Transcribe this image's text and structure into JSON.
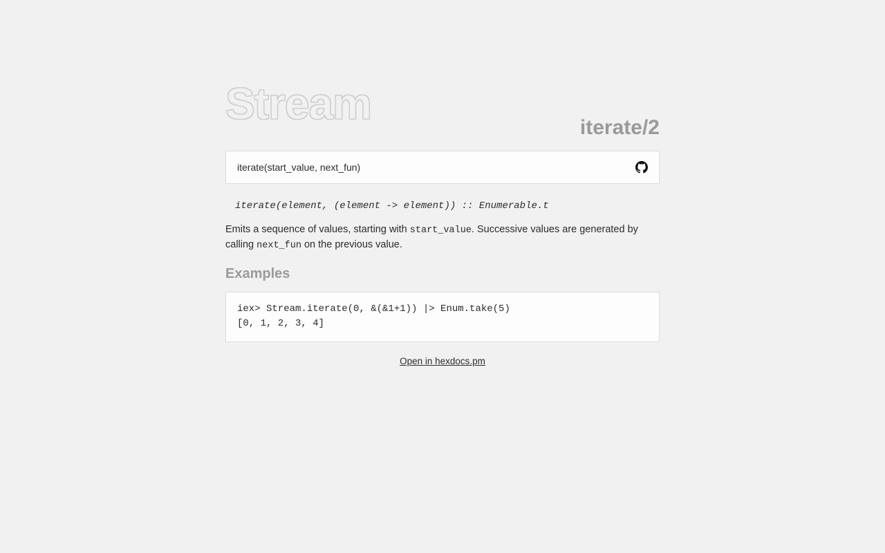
{
  "module": "Stream",
  "function_heading": "iterate/2",
  "signature": "iterate(start_value, next_fun)",
  "spec": "iterate(element, (element -> element)) :: Enumerable.t",
  "description_parts": {
    "p1": "Emits a sequence of values, starting with ",
    "code1": "start_value",
    "p2": ". Successive values are generated by calling ",
    "code2": "next_fun",
    "p3": " on the previous value."
  },
  "examples_heading": "Examples",
  "example_code": "iex> Stream.iterate(0, &(&1+1)) |> Enum.take(5)\n[0, 1, 2, 3, 4]",
  "footer_link": "Open in hexdocs.pm"
}
